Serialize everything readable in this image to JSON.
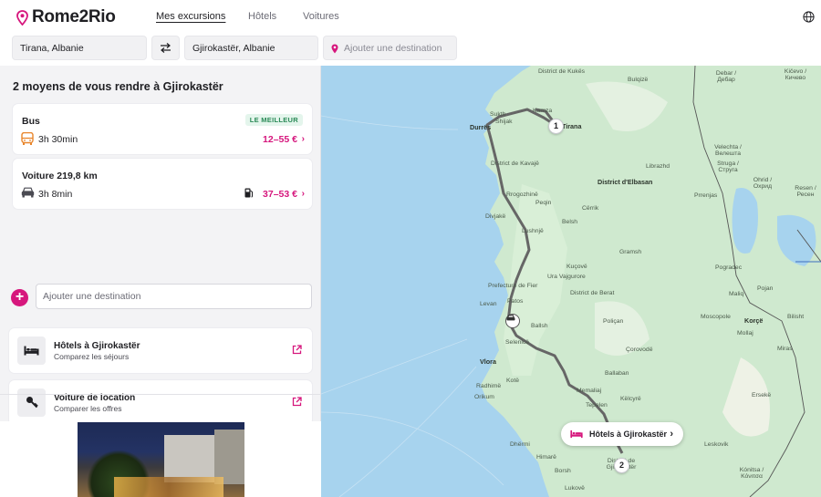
{
  "header": {
    "brand": "Rome2Rio",
    "nav": [
      "Mes excursions",
      "Hôtels",
      "Voitures"
    ]
  },
  "search": {
    "origin": "Tirana, Albanie",
    "destination": "Gjirokastër, Albanie",
    "add_destination_placeholder": "Ajouter une destination"
  },
  "panel": {
    "title": "2 moyens de vous rendre à Gjirokastër",
    "routes": [
      {
        "name": "Bus",
        "duration": "3h 30min",
        "price": "12–55 €",
        "badge": "LE MEILLEUR",
        "icon": "bus-icon"
      },
      {
        "name": "Voiture 219,8 km",
        "duration": "3h 8min",
        "price": "37–53 €",
        "icon": "car-icon"
      }
    ],
    "add_destination": "Ajouter une destination",
    "links": [
      {
        "title": "Hôtels à Gjirokastër",
        "subtitle": "Comparez les séjours",
        "icon": "bed-icon"
      },
      {
        "title": "Voiture de location",
        "subtitle": "Comparer les offres",
        "icon": "key-icon"
      }
    ]
  },
  "map": {
    "hotels_button": "Hôtels à Gjirokastër",
    "markers": [
      "1",
      "2"
    ],
    "places": [
      "District de Kukës",
      "Bulqizë",
      "Kamza",
      "Sukth",
      "Shijak",
      "Durrës",
      "Tirana",
      "District de Kavajë",
      "Rrogozhinë",
      "Peqin",
      "Divjakë",
      "Lushnjë",
      "District d'Elbasan",
      "Cërrik",
      "Belsh",
      "Librazhd",
      "Gramsh",
      "Kuçovë",
      "Ura Vajgurore",
      "District de Berat",
      "Prefecture de Fier",
      "Levan",
      "Patos",
      "Ballsh",
      "Poliçan",
      "Selenicë",
      "Çorovodë",
      "Vlora",
      "Ballaban",
      "Kotë",
      "Memaliaj",
      "Radhimë",
      "Orikum",
      "Tepelen",
      "Këlcyrë",
      "Dhërmi",
      "Himarë",
      "Borsh",
      "Lukovë",
      "District de Gjirokastër",
      "Kičevo / Кичево",
      "Debar / Дебар",
      "Velechta / Велешта",
      "Struga / Струга",
      "Ohrid / Охрид",
      "Resen / Ресен",
      "Prrenjas",
      "Pogradec",
      "Maliq",
      "Pojan",
      "Moscopole",
      "Korçë",
      "Bilisht",
      "Mollaj",
      "Miras",
      "Ersekë",
      "Leskovik",
      "Kónitsa / Κόνιτσα"
    ]
  },
  "colors": {
    "accent": "#d6177d",
    "bus": "#e8852b",
    "route": "#666666"
  }
}
